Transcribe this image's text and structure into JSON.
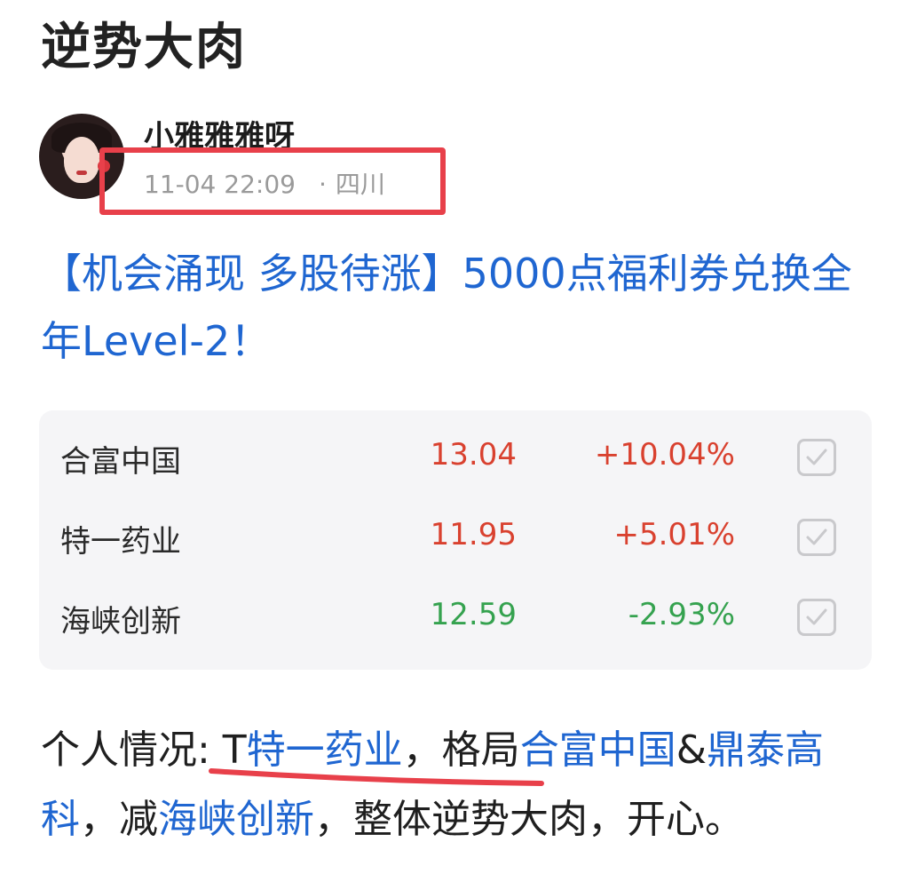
{
  "post": {
    "title": "逆势大肉"
  },
  "author": {
    "name": "小雅雅雅呀",
    "time": "11-04 22:09",
    "separator": "·",
    "location": "四川"
  },
  "headline": "【机会涌现 多股待涨】5000点福利券兑换全年Level-2！",
  "stocks": [
    {
      "name": "合富中国",
      "price": "13.04",
      "change": "+10.04%",
      "trend": "up"
    },
    {
      "name": "特一药业",
      "price": "11.95",
      "change": "+5.01%",
      "trend": "up"
    },
    {
      "name": "海峡创新",
      "price": "12.59",
      "change": "-2.93%",
      "trend": "down"
    }
  ],
  "comment": {
    "prefix": "个人情况: T",
    "link1": "特一药业",
    "mid1": "，格局",
    "link2": "合富中国",
    "amp": "&",
    "link3": "鼎泰高科",
    "mid2": "，减",
    "link4": "海峡创新",
    "suffix": "，整体逆势大肉，开心。"
  },
  "colors": {
    "link": "#1f66d1",
    "up": "#d9412f",
    "down": "#35a24f",
    "annotation": "#e8404a"
  },
  "icons": {
    "check": "check-icon",
    "avatar": "avatar-image"
  }
}
